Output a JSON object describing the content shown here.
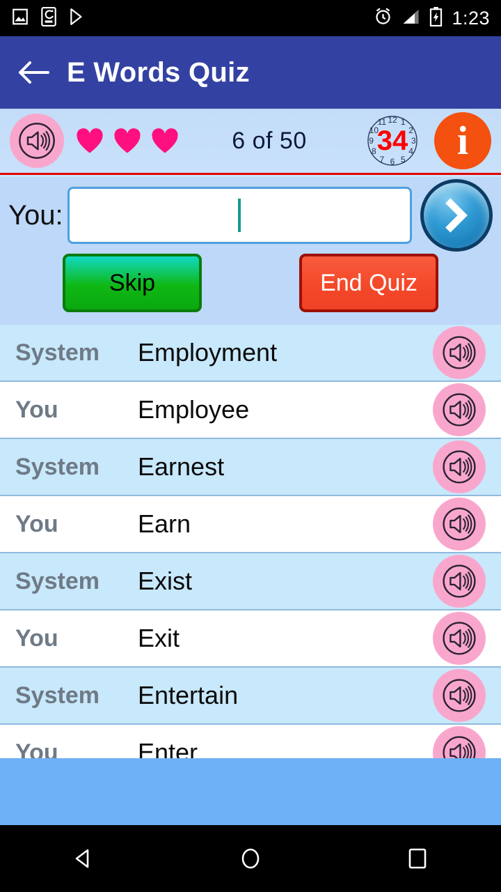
{
  "statusbar": {
    "time": "1:23",
    "left_icons": [
      "image-icon",
      "phone-sync-icon",
      "play-store-icon"
    ],
    "right_icons": [
      "alarm-icon",
      "signal-icon",
      "battery-charging-icon"
    ]
  },
  "appbar": {
    "back_icon": "back-arrow-icon",
    "title": "E Words Quiz"
  },
  "quizbar": {
    "speaker_icon": "speaker-icon",
    "lives": 3,
    "heart_color": "#ff0f7f",
    "progress": "6 of 50",
    "timer_value": "34",
    "clock_numerals": [
      "12",
      "1",
      "2",
      "3",
      "4",
      "5",
      "6",
      "7",
      "8",
      "9",
      "10",
      "11"
    ],
    "info_label": "i",
    "info_color": "#f4500f",
    "divider_color": "#e00000"
  },
  "answer_area": {
    "you_label": "You:",
    "input_value": "",
    "input_placeholder": "",
    "submit_icon": "chevron-right-icon",
    "skip_label": "Skip",
    "end_label": "End Quiz",
    "skip_color": "#0fb814",
    "end_color": "#f4482a"
  },
  "history": {
    "rows": [
      {
        "speaker": "System",
        "word": "Employment",
        "icon": "speaker-icon"
      },
      {
        "speaker": "You",
        "word": "Employee",
        "icon": "speaker-icon"
      },
      {
        "speaker": "System",
        "word": "Earnest",
        "icon": "speaker-icon"
      },
      {
        "speaker": "You",
        "word": "Earn",
        "icon": "speaker-icon"
      },
      {
        "speaker": "System",
        "word": "Exist",
        "icon": "speaker-icon"
      },
      {
        "speaker": "You",
        "word": "Exit",
        "icon": "speaker-icon"
      },
      {
        "speaker": "System",
        "word": "Entertain",
        "icon": "speaker-icon"
      },
      {
        "speaker": "You",
        "word": "Enter",
        "icon": "speaker-icon"
      }
    ]
  },
  "navbar": {
    "back_icon": "nav-back-icon",
    "home_icon": "nav-home-icon",
    "recents_icon": "nav-recents-icon"
  }
}
